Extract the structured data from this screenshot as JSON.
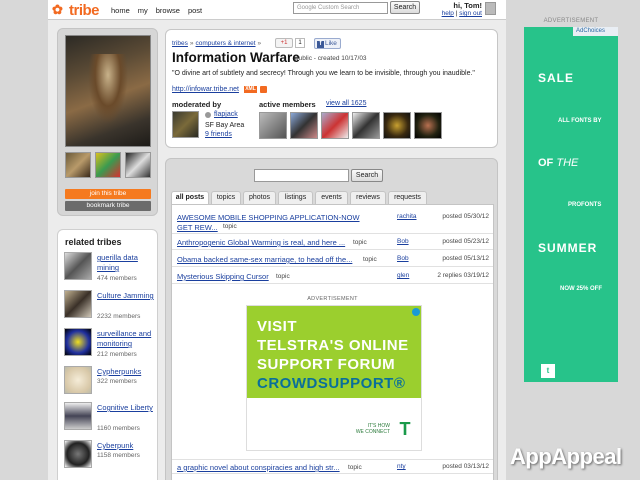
{
  "topbar": {
    "logo_text": "tribe",
    "nav": [
      "home",
      "my",
      "browse",
      "post"
    ],
    "search_placeholder": "Google Custom Search",
    "search_button": "Search",
    "greeting": "hi, Tom!",
    "help": "help",
    "sign_out": "sign out"
  },
  "tribe": {
    "join_label": "join this tribe",
    "bookmark_label": "bookmark tribe",
    "breadcrumb": [
      "tribes",
      "computers & internet"
    ],
    "gplus_label": "+1",
    "gplus_count": "1",
    "fb_like": "Like",
    "title": "Information Warfare",
    "meta": "public - created 10/17/03",
    "quote": "\"O divine art of subtlety and secrecy! Through you we learn to be invisible, through you inaudible.\"",
    "url": "http://infowar.tribe.net",
    "xml_badge": "XML",
    "moderated_by": "moderated by",
    "moderator_name": "flapjack",
    "moderator_location": "SF Bay Area",
    "moderator_friends": "9 friends",
    "active_members": "active members",
    "view_all": "view all 1625"
  },
  "related": {
    "title": "related tribes",
    "items": [
      {
        "name": "guerilla data mining",
        "count": "474 members"
      },
      {
        "name": "Culture Jamming",
        "count": "2232 members"
      },
      {
        "name": "surveillance and monitoring",
        "count": "212 members"
      },
      {
        "name": "Cypherpunks",
        "count": "322 members"
      },
      {
        "name": "Cognitive Liberty",
        "count": "1160 members"
      },
      {
        "name": "Cyberpunk",
        "count": "1158 members"
      }
    ]
  },
  "posts": {
    "search_button": "Search",
    "tabs": [
      "all posts",
      "topics",
      "photos",
      "listings",
      "events",
      "reviews",
      "requests"
    ],
    "rows": [
      {
        "title": "AWESOME MOBILE SHOPPING APPLICATION-NOW GET REW...",
        "tag": "topic",
        "author": "rachita",
        "date": "posted 05/30/12"
      },
      {
        "title": "Anthropogenic Global Warming is real, and here ...",
        "tag": "topic",
        "author": "Bob",
        "date": "posted 05/23/12"
      },
      {
        "title": "Obama backed same-sex marriage, to head off the...",
        "tag": "topic",
        "author": "Bob",
        "date": "posted 05/13/12"
      },
      {
        "title": "Mysterious Skipping Cursor",
        "tag": "topic",
        "author": "glen",
        "date": "2 replies 03/19/12"
      }
    ],
    "ad_label": "ADVERTISEMENT",
    "last_row": {
      "title": "a graphic novel about conspiracies and high str...",
      "tag": "topic",
      "author": "nty",
      "date": "posted 03/13/12"
    }
  },
  "telstra_ad": {
    "lines": [
      "VISIT",
      "TELSTRA'S ONLINE",
      "SUPPORT FORUM",
      "CROWDSUPPORT®"
    ],
    "tagline_1": "IT'S HOW",
    "tagline_2": "WE CONNECT",
    "logo_glyph": "T"
  },
  "right_ad": {
    "label": "ADVERTISEMENT",
    "adchoices": "AdChoices",
    "sale": "SALE",
    "all_fonts": "ALL FONTS BY",
    "of": "OF",
    "the": "THE",
    "profonts": "PROFONTS",
    "summer": "SUMMER",
    "now_off": "NOW 25% OFF",
    "social_glyph": "t"
  },
  "watermark": "AppAppeal",
  "colors": {
    "brand_orange": "#f26a21",
    "link_blue": "#1a3f9e",
    "ad_green": "#27c38a",
    "telstra_green": "#9bcf2e"
  }
}
